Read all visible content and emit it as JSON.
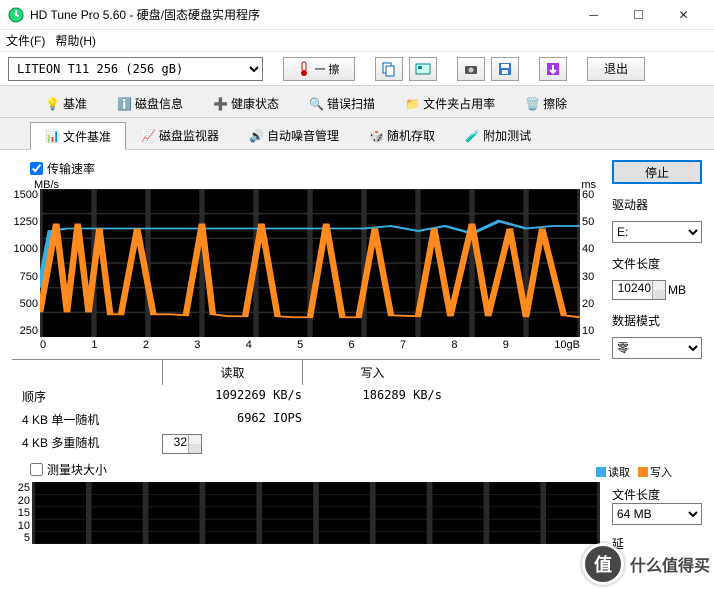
{
  "window": {
    "title": "HD Tune Pro 5.60 - 硬盘/固态硬盘实用程序"
  },
  "menu": {
    "file": "文件(F)",
    "help": "帮助(H)"
  },
  "toolbar": {
    "drive": "LITEON T11 256 (256 gB)",
    "temp_sep": "一  擦",
    "exit": "退出"
  },
  "tabs_top": [
    {
      "label": "基准"
    },
    {
      "label": "磁盘信息"
    },
    {
      "label": "健康状态"
    },
    {
      "label": "错误扫描"
    },
    {
      "label": "文件夹占用率"
    },
    {
      "label": "擦除"
    }
  ],
  "tabs_bottom": [
    {
      "label": "文件基准",
      "active": true
    },
    {
      "label": "磁盘监视器"
    },
    {
      "label": "自动噪音管理"
    },
    {
      "label": "随机存取"
    },
    {
      "label": "附加测试"
    }
  ],
  "checkbox": {
    "transfer_rate": "传输速率",
    "block_size": "测量块大小"
  },
  "chart_data": {
    "type": "line",
    "ylabel_left": "MB/s",
    "ylabel_right": "ms",
    "y_left_ticks": [
      1500,
      1250,
      1000,
      750,
      500,
      250
    ],
    "y_right_ticks": [
      60,
      50,
      40,
      30,
      20,
      10
    ],
    "x_ticks": [
      "0",
      "1",
      "2",
      "3",
      "4",
      "5",
      "6",
      "7",
      "8",
      "9",
      "10gB"
    ],
    "series": [
      {
        "name": "access_time_ms",
        "color": "#36b0e0",
        "x": [
          0,
          0.2,
          0.5,
          1,
          2,
          3,
          4,
          5,
          6,
          6.5,
          7,
          7.5,
          8,
          8.5,
          9,
          9.5,
          10
        ],
        "y": [
          20,
          43,
          44,
          44,
          44,
          44,
          44,
          44,
          44,
          45,
          43,
          45,
          42,
          47,
          44,
          45,
          45
        ]
      },
      {
        "name": "transfer_MBs",
        "color": "#ff8a1f",
        "x": [
          0,
          0.3,
          0.5,
          0.7,
          0.9,
          1.1,
          1.3,
          1.5,
          1.8,
          2.1,
          2.4,
          2.7,
          3.0,
          3.2,
          3.5,
          3.8,
          4.1,
          4.4,
          4.7,
          5.0,
          5.3,
          5.6,
          5.9,
          6.2,
          6.5,
          7.0,
          7.3,
          7.6,
          8.0,
          8.3,
          8.7,
          9.0,
          9.3,
          9.7,
          10
        ],
        "y": [
          250,
          1150,
          250,
          1150,
          250,
          1100,
          230,
          230,
          1100,
          230,
          230,
          220,
          1150,
          230,
          210,
          210,
          1150,
          210,
          200,
          200,
          1150,
          200,
          200,
          1100,
          220,
          210,
          1100,
          210,
          1150,
          210,
          1100,
          200,
          1100,
          220,
          200
        ]
      }
    ]
  },
  "results": {
    "head_read": "读取",
    "head_write": "写入",
    "rows": [
      {
        "label": "顺序",
        "read": "1092269 KB/s",
        "write": "186289 KB/s"
      },
      {
        "label": "4 KB 单一随机",
        "read": "6962 IOPS",
        "write": ""
      },
      {
        "label": "4 KB 多重随机",
        "spin": "32",
        "read": "",
        "write": ""
      }
    ]
  },
  "side": {
    "stop": "停止",
    "drive_label": "驱动器",
    "drive_value": "E:",
    "filelen_label": "文件长度",
    "filelen_value": "10240",
    "filelen_unit": "MB",
    "datamode_label": "数据模式",
    "datamode_value": "零",
    "filelen2_label": "文件长度",
    "filelen2_value": "64 MB",
    "delay_label": "延"
  },
  "legend": {
    "read": "读取",
    "write": "写入"
  },
  "chart2": {
    "y_ticks": [
      25,
      20,
      15,
      10,
      5
    ]
  },
  "watermark": {
    "badge": "值",
    "text": "什么值得买"
  }
}
